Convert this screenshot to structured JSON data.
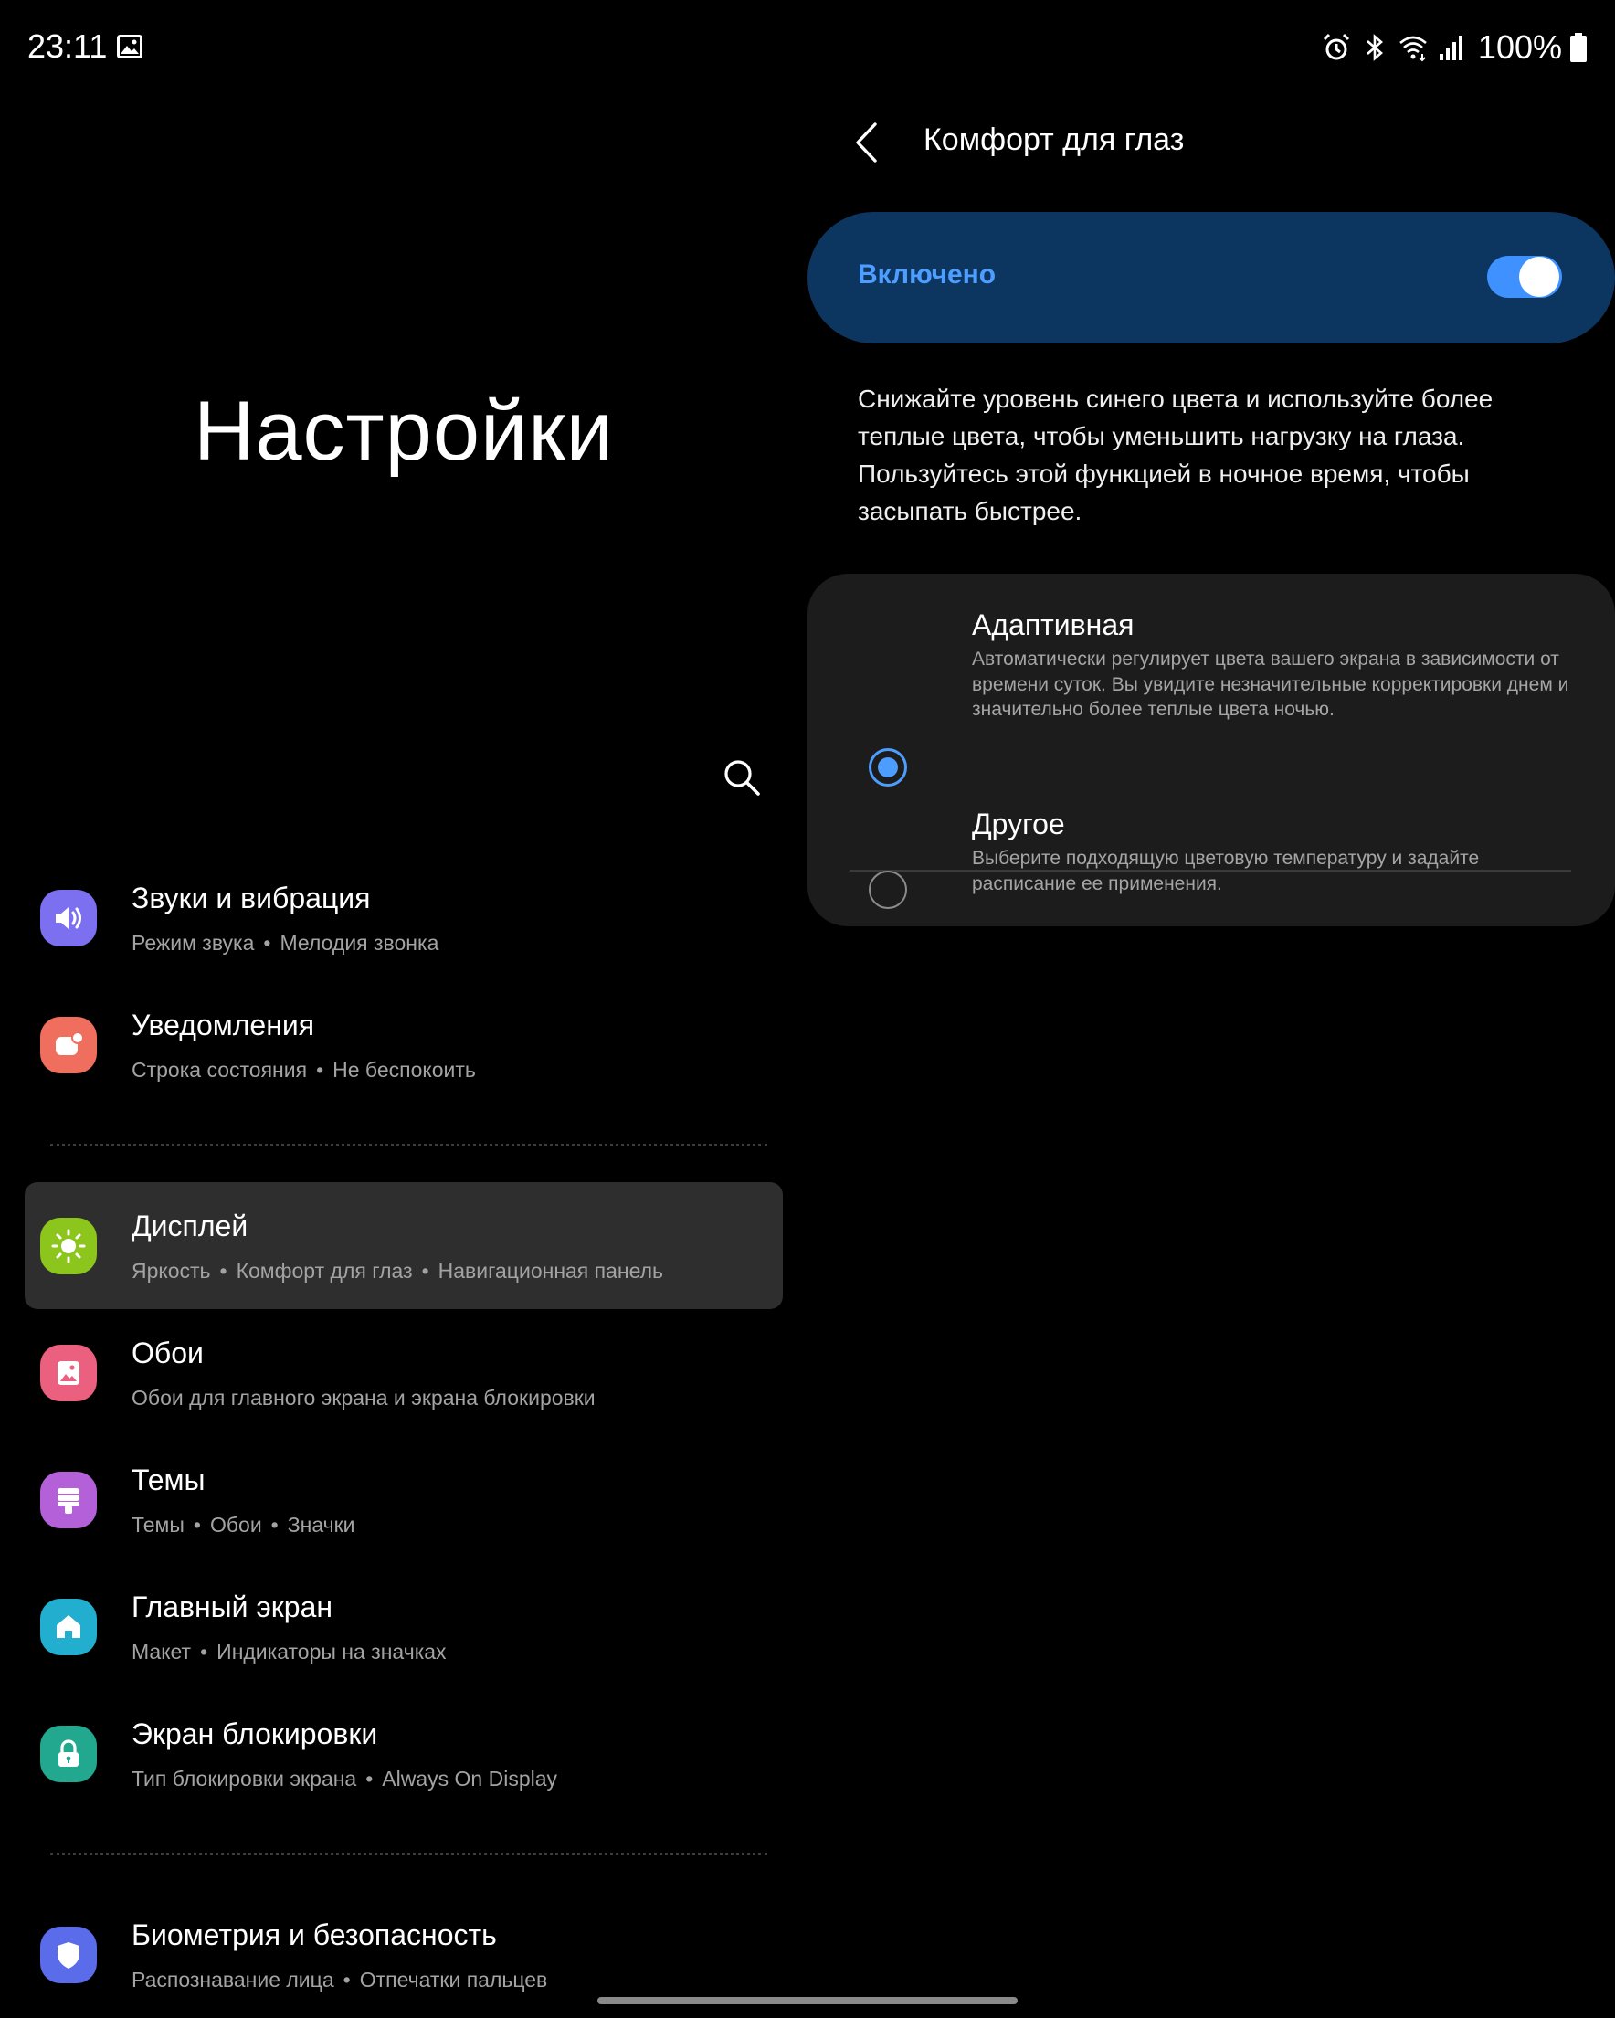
{
  "status_bar": {
    "time": "23:11",
    "battery": "100%",
    "icons": [
      "gallery-icon",
      "alarm-icon",
      "bluetooth-icon",
      "wifi-icon",
      "signal-icon",
      "battery-icon"
    ]
  },
  "settings": {
    "title": "Настройки",
    "search_icon": "search-icon",
    "items": [
      {
        "title": "Звуки и вибрация",
        "sub": [
          "Режим звука",
          "Мелодия звонка"
        ],
        "icon": "volume-icon",
        "color": "#7c6ff0"
      },
      {
        "title": "Уведомления",
        "sub": [
          "Строка состояния",
          "Не беспокоить"
        ],
        "icon": "notification-icon",
        "color": "#f06e5d"
      },
      {
        "title": "Дисплей",
        "sub": [
          "Яркость",
          "Комфорт для глаз",
          "Навигационная панель"
        ],
        "icon": "brightness-icon",
        "color": "#8cc61d",
        "selected": true
      },
      {
        "title": "Обои",
        "sub": [
          "Обои для главного экрана и экрана блокировки"
        ],
        "icon": "wallpaper-icon",
        "color": "#eb5f7f"
      },
      {
        "title": "Темы",
        "sub": [
          "Темы",
          "Обои",
          "Значки"
        ],
        "icon": "themes-icon",
        "color": "#b460d8"
      },
      {
        "title": "Главный экран",
        "sub": [
          "Макет",
          "Индикаторы на значках"
        ],
        "icon": "home-icon",
        "color": "#22afcf"
      },
      {
        "title": "Экран блокировки",
        "sub": [
          "Тип блокировки экрана",
          "Always On Display"
        ],
        "icon": "lock-icon",
        "color": "#21a88f"
      },
      {
        "title": "Биометрия и безопасность",
        "sub": [
          "Распознавание лица",
          "Отпечатки пальцев"
        ],
        "icon": "shield-icon",
        "color": "#5b6cea"
      }
    ]
  },
  "eye_comfort": {
    "title": "Комфорт для глаз",
    "master_label": "Включено",
    "master_on": true,
    "description": "Снижайте уровень синего цвета и используйте более теплые цвета, чтобы уменьшить нагрузку на глаза. Пользуйтесь этой функцией в ночное время, чтобы засыпать быстрее.",
    "options": [
      {
        "title": "Адаптивная",
        "desc": "Автоматически регулирует цвета вашего экрана в зависимости от времени суток. Вы увидите незначительные корректировки днем и значительно более теплые цвета ночью.",
        "checked": true
      },
      {
        "title": "Другое",
        "desc": "Выберите подходящую цветовую температуру и задайте расписание ее применения.",
        "checked": false
      }
    ]
  },
  "colors": {
    "accent": "#4e9eff",
    "master_bar": "#0c3560",
    "card": "#1c1c1c",
    "selected_row": "#2e2e2e"
  }
}
